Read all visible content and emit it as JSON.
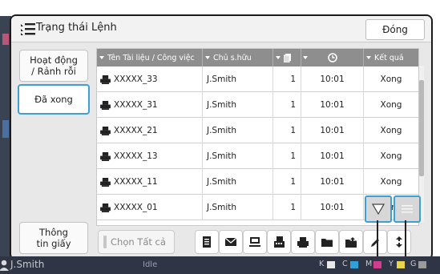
{
  "window": {
    "title": "Trạng thái Lệnh",
    "close_label": "Đóng"
  },
  "tabs": [
    {
      "label": "Hoạt động\n/ Rảnh rỗi",
      "active": false
    },
    {
      "label": "Đã xong",
      "active": true
    },
    {
      "label": "Thông\ntin giấy",
      "active": false
    }
  ],
  "table": {
    "headers": {
      "document": "Tên Tài liệu / Công việc",
      "owner": "Chủ s.hữu",
      "copies_icon": "copies-icon",
      "time_icon": "clock-icon",
      "result": "Kết quả"
    },
    "rows": [
      {
        "name": "XXXXX_33",
        "owner": "J.Smith",
        "copies": "1",
        "time": "10:01",
        "result": "Xong"
      },
      {
        "name": "XXXXX_31",
        "owner": "J.Smith",
        "copies": "1",
        "time": "10:01",
        "result": "Xong"
      },
      {
        "name": "XXXXX_21",
        "owner": "J.Smith",
        "copies": "1",
        "time": "10:01",
        "result": "Xong"
      },
      {
        "name": "XXXXX_13",
        "owner": "J.Smith",
        "copies": "1",
        "time": "10:01",
        "result": "Xong"
      },
      {
        "name": "XXXXX_11",
        "owner": "J.Smith",
        "copies": "1",
        "time": "10:01",
        "result": "Xong"
      },
      {
        "name": "XXXXX_01",
        "owner": "J.Smith",
        "copies": "1",
        "time": "10:01",
        "result": "Xong"
      }
    ]
  },
  "toolbar": {
    "select_all_label": "Chọn Tất cả",
    "icons": [
      "document-icon",
      "mail-icon",
      "computer-icon",
      "fax-icon",
      "printer-icon",
      "folder-icon",
      "folder-upload-icon",
      "pen-icon",
      "arrows-icon"
    ]
  },
  "overlay_buttons": {
    "sort_icon": "triangle-down-icon",
    "menu_icon": "list-icon"
  },
  "status_bar": {
    "user": "J.Smith",
    "state": "Idle",
    "ink_labels": [
      "K",
      "C",
      "M",
      "Y",
      "G"
    ],
    "ink_colors": [
      "#e8e8e8",
      "#2fa0d8",
      "#d23d8e",
      "#e8d44a",
      "#9a9a9a"
    ]
  },
  "colors": {
    "accent": "#3d9fd6",
    "header_bg": "#8e8e8e",
    "status_bg": "#2f3544"
  }
}
